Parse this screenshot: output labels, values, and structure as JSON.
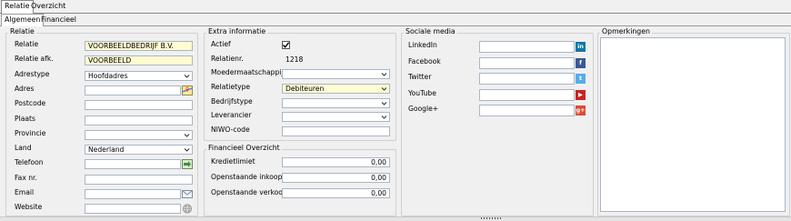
{
  "tabs": {
    "relatie": "Relatie",
    "overzicht": "Overzicht"
  },
  "subtabs": {
    "algemeen": "Algemeen",
    "financieel": "Financieel"
  },
  "relatie": {
    "group": "Relatie",
    "fields": [
      {
        "label": "Relatie",
        "value": "VOORBEELDBEDRIJF B.V.",
        "type": "text",
        "yellow": true
      },
      {
        "label": "Relatie afk.",
        "value": "VOORBEELD",
        "type": "text",
        "yellow": true
      },
      {
        "label": "Adrestype",
        "value": "Hoofdadres",
        "type": "select"
      },
      {
        "label": "Adres",
        "value": "",
        "type": "map"
      },
      {
        "label": "Postcode",
        "value": "",
        "type": "text"
      },
      {
        "label": "Plaats",
        "value": "",
        "type": "text"
      },
      {
        "label": "Provincie",
        "value": "",
        "type": "select"
      },
      {
        "label": "Land",
        "value": "Nederland",
        "type": "select"
      },
      {
        "label": "Telefoon",
        "value": "",
        "type": "phone"
      },
      {
        "label": "Fax nr.",
        "value": "",
        "type": "text"
      },
      {
        "label": "Email",
        "value": "",
        "type": "email"
      },
      {
        "label": "Website",
        "value": "",
        "type": "web"
      }
    ]
  },
  "extra": {
    "group": "Extra informatie",
    "actief_label": "Actief",
    "actief": true,
    "relatienr_label": "Relatienr.",
    "relatienr": "1218",
    "fields": [
      {
        "label": "Moedermaatschappij",
        "value": "",
        "yellow": false
      },
      {
        "label": "Relatietype",
        "value": "Debiteuren",
        "yellow": true
      },
      {
        "label": "Bedrijfstype",
        "value": "",
        "yellow": false
      },
      {
        "label": "Leverancier",
        "value": "",
        "yellow": false
      }
    ],
    "niwo_label": "NIWO-code",
    "niwo": ""
  },
  "financieel": {
    "group": "Financieel Overzicht",
    "rows": [
      {
        "label": "Kredietlimiet",
        "value": "0,00"
      },
      {
        "label": "Openstaande inkoop",
        "value": "0,00"
      },
      {
        "label": "Openstaande verkoop",
        "value": "0,00"
      }
    ]
  },
  "social": {
    "group": "Sociale media",
    "items": [
      {
        "label": "LinkedIn",
        "value": "",
        "icon": "linkedin-icon",
        "glyph": "in",
        "color": "#0e76a8"
      },
      {
        "label": "Facebook",
        "value": "",
        "icon": "facebook-icon",
        "glyph": "f",
        "color": "#3b5998"
      },
      {
        "label": "Twitter",
        "value": "",
        "icon": "twitter-icon",
        "glyph": "t",
        "color": "#55acee"
      },
      {
        "label": "YouTube",
        "value": "",
        "icon": "youtube-icon",
        "glyph": "▶",
        "color": "#cc2222"
      },
      {
        "label": "Google+",
        "value": "",
        "icon": "googleplus-icon",
        "glyph": "g+",
        "color": "#dd4b39"
      }
    ]
  },
  "opmerkingen": {
    "group": "Opmerkingen",
    "value": ""
  }
}
